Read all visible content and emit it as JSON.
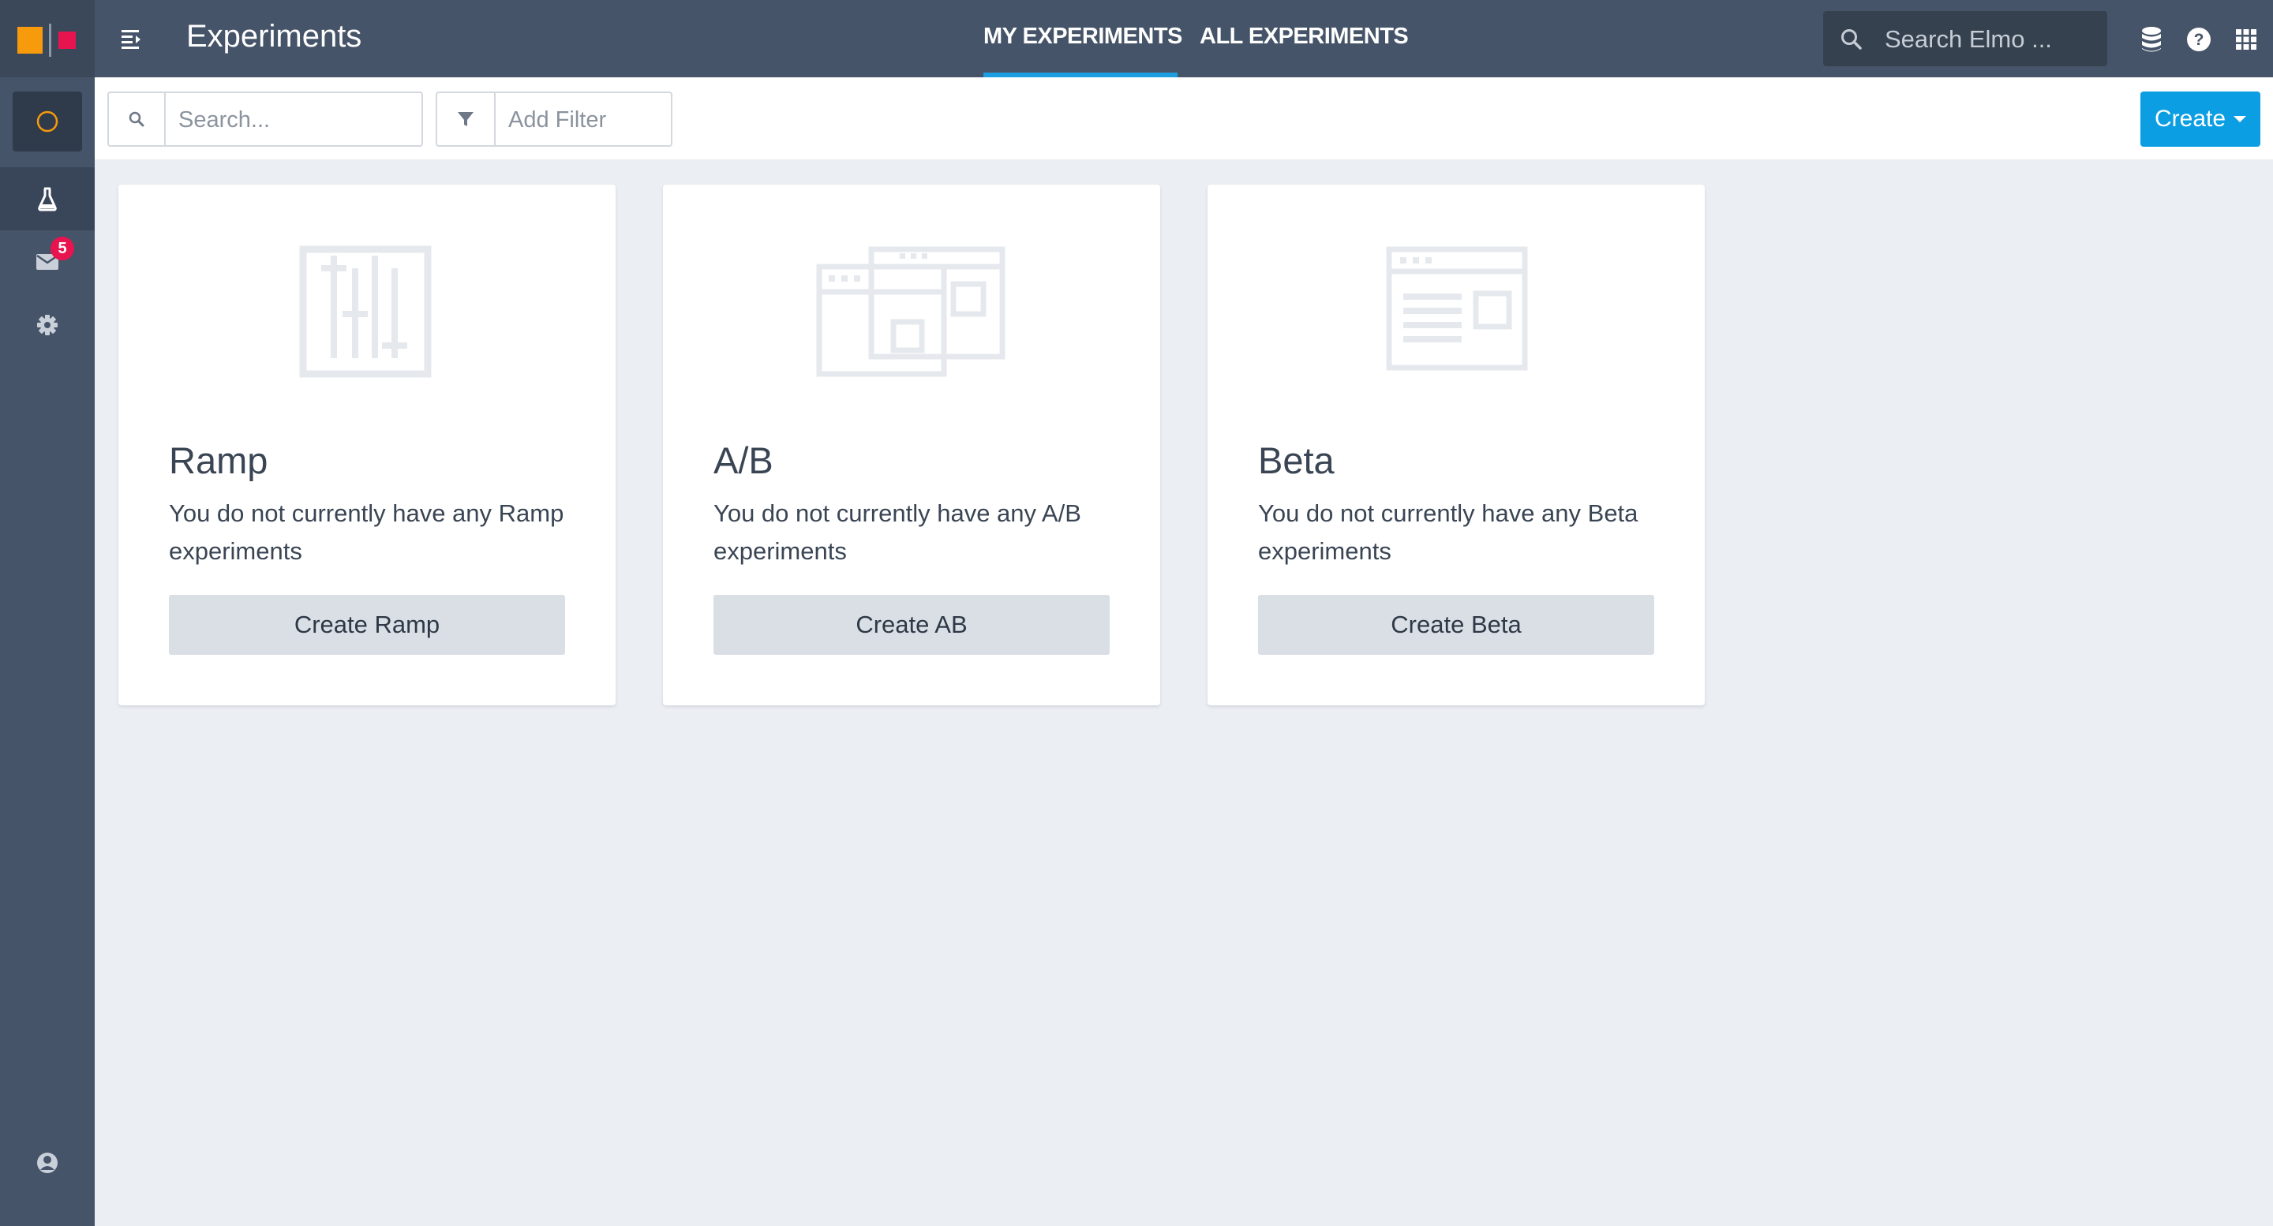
{
  "app": {
    "title": "Experiments"
  },
  "sidebar": {
    "items": [
      {
        "name": "home",
        "icon": "circle-icon"
      },
      {
        "name": "experiments",
        "icon": "flask-icon"
      },
      {
        "name": "messages",
        "icon": "mail-icon",
        "badge": "5"
      },
      {
        "name": "settings",
        "icon": "gear-icon"
      },
      {
        "name": "profile",
        "icon": "user-circle-icon"
      }
    ]
  },
  "header": {
    "tabs": [
      {
        "label": "MY EXPERIMENTS",
        "active": true
      },
      {
        "label": "ALL EXPERIMENTS",
        "active": false
      }
    ],
    "search_placeholder": "Search Elmo ..."
  },
  "toolbar": {
    "search_placeholder": "Search...",
    "filter_label": "Add Filter",
    "create_label": "Create"
  },
  "cards": [
    {
      "title": "Ramp",
      "description": "You do not currently have any Ramp experiments",
      "button": "Create Ramp"
    },
    {
      "title": "A/B",
      "description": "You do not currently have any A/B experiments",
      "button": "Create AB"
    },
    {
      "title": "Beta",
      "description": "You do not currently have any Beta experiments",
      "button": "Create Beta"
    }
  ],
  "colors": {
    "sidebar": "#455468",
    "accent": "#0b9ee3",
    "logo_orange": "#f79a0c",
    "logo_pink": "#e8144f",
    "background": "#ebeef3"
  }
}
